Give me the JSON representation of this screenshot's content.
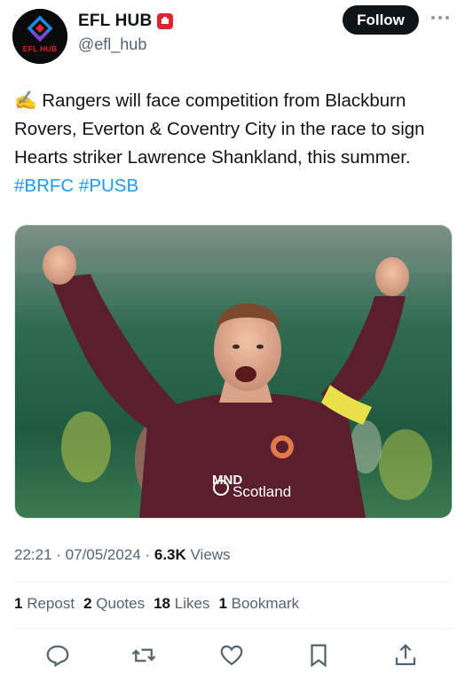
{
  "author": {
    "display_name": "EFL HUB",
    "handle": "@efl_hub",
    "avatar_text": "EFL HUB"
  },
  "follow_label": "Follow",
  "tweet": {
    "emoji": "✍️",
    "text": "Rangers will face competition from Blackburn Rovers, Everton & Coventry City in the race to sign Hearts striker Lawrence Shankland, this summer.",
    "hashtags": [
      "#BRFC",
      "#PUSB"
    ]
  },
  "media": {
    "description_text": "Scotland",
    "sponsor_text": "MND"
  },
  "meta": {
    "time": "22:21",
    "date": "07/05/2024",
    "views_count": "6.3K",
    "views_label": "Views"
  },
  "stats": {
    "reposts_count": "1",
    "reposts_label": "Repost",
    "quotes_count": "2",
    "quotes_label": "Quotes",
    "likes_count": "18",
    "likes_label": "Likes",
    "bookmarks_count": "1",
    "bookmarks_label": "Bookmark"
  },
  "actions": [
    "reply-icon",
    "repost-icon",
    "like-icon",
    "bookmark-icon",
    "share-icon"
  ],
  "colors": {
    "accent": "#1d9bf0",
    "text": "#0f1419",
    "muted": "#536471",
    "badge": "#e0232e",
    "shirt": "#5a1e2c"
  }
}
